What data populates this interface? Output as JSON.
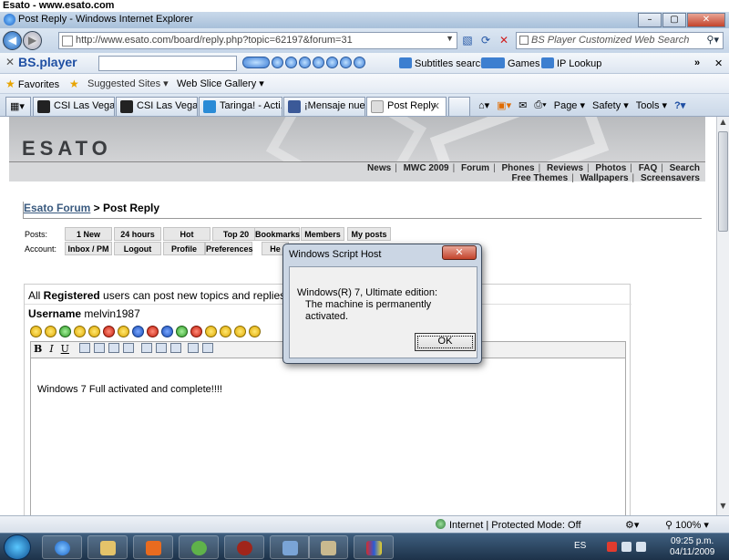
{
  "watermark": "Esato - www.esato.com",
  "window": {
    "title": "Post Reply - Windows Internet Explorer"
  },
  "address": {
    "url": "http://www.esato.com/board/reply.php?topic=62197&forum=31"
  },
  "search": {
    "placeholder": "BS Player Customized Web Search"
  },
  "bstoolbar": {
    "logo": "BS.player",
    "items": [
      "Subtitles search",
      "Games",
      "IP Lookup"
    ]
  },
  "favbar": {
    "favorites": "Favorites",
    "suggested": "Suggested Sites",
    "webslice": "Web Slice Gallery"
  },
  "tabs": [
    {
      "label": "CSI Las Vegas ...",
      "color": "#1f1f1f"
    },
    {
      "label": "CSI Las Vegas -...",
      "color": "#1f1f1f"
    },
    {
      "label": "Taringa! - Acti...",
      "color": "#2a8bd6"
    },
    {
      "label": "¡Mensaje nuev...",
      "color": "#3b5998"
    },
    {
      "label": "Post Reply",
      "color": "#e0e0e0"
    }
  ],
  "tabtools": {
    "page": "Page",
    "safety": "Safety",
    "tools": "Tools"
  },
  "site": {
    "logo": "ESATO",
    "nav_row1": [
      "News",
      "MWC 2009",
      "Forum",
      "Phones",
      "Reviews",
      "Photos",
      "FAQ",
      "Search"
    ],
    "nav_row2": [
      "Free Themes",
      "Wallpapers",
      "Screensavers"
    ]
  },
  "breadcrumb": {
    "link": "Esato Forum",
    "sep": " > ",
    "current": "Post Reply"
  },
  "forumnav": {
    "posts_label": "Posts:",
    "posts": [
      "1 New",
      "24 hours",
      "Hot",
      "Top 20",
      "Bookmarks",
      "Members",
      "My posts"
    ],
    "account_label": "Account:",
    "account": [
      "Inbox / PM",
      "Logout",
      "Profile",
      "Preferences",
      "He"
    ]
  },
  "post": {
    "info_pre": "All ",
    "info_bold": "Registered",
    "info_post": " users can post new topics and replies",
    "username_label": "Username",
    "username": "melvin1987",
    "editor_text": "Windows 7 Full activated and complete!!!!"
  },
  "dialog": {
    "title": "Windows Script Host",
    "line1": "Windows(R) 7, Ultimate edition:",
    "line2": "The machine is permanently activated.",
    "ok": "OK"
  },
  "status": {
    "zone": "Internet | Protected Mode: Off",
    "zoom": "100%"
  },
  "taskbar": {
    "lang": "ES",
    "time": "09:25 p.m.",
    "date": "04/11/2009"
  }
}
